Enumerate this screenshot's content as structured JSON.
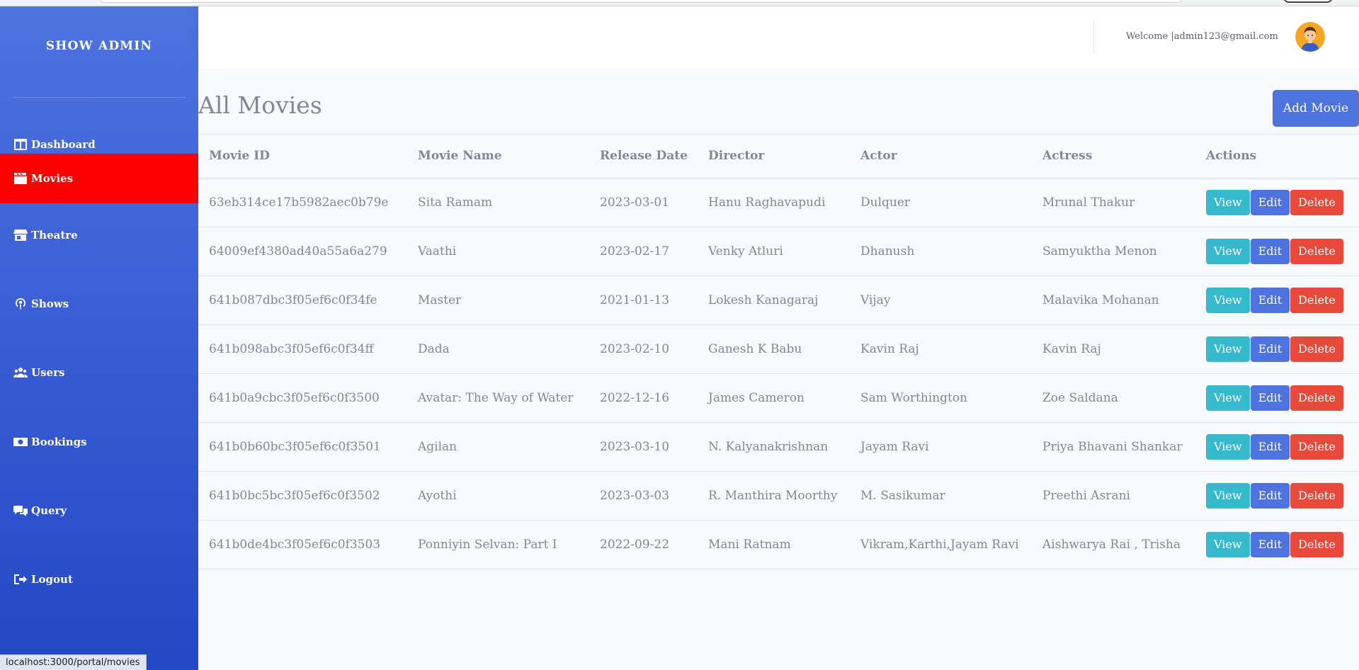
{
  "sidebar": {
    "brand": "SHOW ADMIN",
    "items": [
      {
        "label": "Dashboard",
        "icon": "columns-icon"
      },
      {
        "label": "Movies",
        "icon": "clapperboard-icon",
        "active": true
      },
      {
        "label": "Theatre",
        "icon": "store-icon"
      },
      {
        "label": "Shows",
        "icon": "podcast-icon"
      },
      {
        "label": "Users",
        "icon": "users-icon"
      },
      {
        "label": "Bookings",
        "icon": "money-bill-icon"
      },
      {
        "label": "Query",
        "icon": "comments-icon"
      },
      {
        "label": "Logout",
        "icon": "sign-out-icon"
      }
    ],
    "active_color": "#ff0000",
    "gradient_top": "#4e73df",
    "gradient_bottom": "#2447c4"
  },
  "status_bar": {
    "url": "localhost:3000/portal/movies"
  },
  "header": {
    "welcome": "Welcome |admin123@gmail.com",
    "avatar_icon": "user-avatar-icon"
  },
  "main": {
    "title": "All Movies",
    "add_button": "Add Movie",
    "table": {
      "columns": [
        "Movie ID",
        "Movie Name",
        "Release Date",
        "Director",
        "Actor",
        "Actress",
        "Actions"
      ],
      "rows": [
        {
          "id": "63eb314ce17b5982aec0b79e",
          "name": "Sita Ramam",
          "release": "2023-03-01",
          "director": "Hanu Raghavapudi",
          "actor": "Dulquer",
          "actress": "Mrunal Thakur"
        },
        {
          "id": "64009ef4380ad40a55a6a279",
          "name": "Vaathi",
          "release": "2023-02-17",
          "director": "Venky Atluri",
          "actor": "Dhanush",
          "actress": "Samyuktha Menon"
        },
        {
          "id": "641b087dbc3f05ef6c0f34fe",
          "name": "Master",
          "release": "2021-01-13",
          "director": "Lokesh Kanagaraj",
          "actor": "Vijay",
          "actress": "Malavika Mohanan"
        },
        {
          "id": "641b098abc3f05ef6c0f34ff",
          "name": "Dada",
          "release": "2023-02-10",
          "director": "Ganesh K Babu",
          "actor": "Kavin Raj",
          "actress": "Kavin Raj"
        },
        {
          "id": "641b0a9cbc3f05ef6c0f3500",
          "name": "Avatar: The Way of Water",
          "release": "2022-12-16",
          "director": "James Cameron",
          "actor": "Sam Worthington",
          "actress": "Zoe Saldana"
        },
        {
          "id": "641b0b60bc3f05ef6c0f3501",
          "name": "Agilan",
          "release": "2023-03-10",
          "director": "N. Kalyanakrishnan",
          "actor": "Jayam Ravi",
          "actress": "Priya Bhavani Shankar"
        },
        {
          "id": "641b0bc5bc3f05ef6c0f3502",
          "name": "Ayothi",
          "release": "2023-03-03",
          "director": "R. Manthira Moorthy",
          "actor": "M. Sasikumar",
          "actress": "Preethi Asrani"
        },
        {
          "id": "641b0de4bc3f05ef6c0f3503",
          "name": "Ponniyin Selvan: Part I",
          "release": "2022-09-22",
          "director": "Mani Ratnam",
          "actor": "Vikram,Karthi,Jayam Ravi",
          "actress": "Aishwarya Rai , Trisha"
        }
      ],
      "actions": {
        "view": "View",
        "edit": "Edit",
        "delete": "Delete"
      }
    }
  },
  "colors": {
    "view": "#36b9cc",
    "edit": "#4e73df",
    "delete": "#e74a3b",
    "text": "#858796"
  }
}
